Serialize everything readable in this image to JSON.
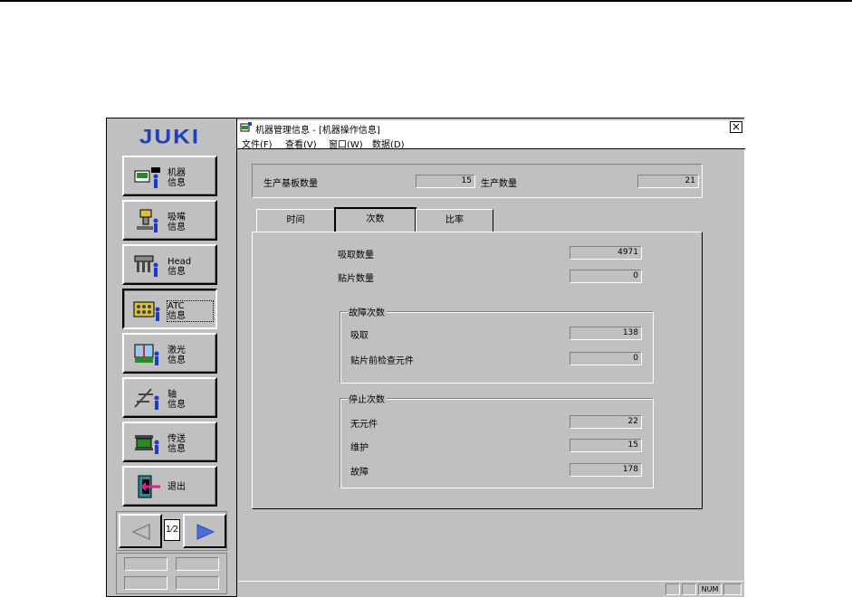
{
  "app": {
    "logo": "JUKI"
  },
  "sidebar": {
    "items": [
      {
        "label": "机器\n信息",
        "icon": "machine-info-icon"
      },
      {
        "label": "吸嘴\n信息",
        "icon": "nozzle-icon"
      },
      {
        "label": "Head\n信息",
        "icon": "head-icon"
      },
      {
        "label": "ATC\n信息",
        "icon": "atc-icon",
        "active": true
      },
      {
        "label": "激光\n信息",
        "icon": "laser-icon"
      },
      {
        "label": "轴\n信息",
        "icon": "axis-icon"
      },
      {
        "label": "传送\n信息",
        "icon": "conveyor-icon"
      },
      {
        "label": "退出",
        "icon": "exit-icon"
      }
    ],
    "pager": {
      "page": "1⁄2"
    }
  },
  "window": {
    "title": "机器管理信息 - [机器操作信息]",
    "close": "×",
    "menu": [
      "文件(F)",
      "查看(V)",
      "窗口(W)",
      "数据(D)"
    ]
  },
  "summary": {
    "board_count_label": "生产基板数量",
    "board_count": "15",
    "production_count_label": "生产数量",
    "production_count": "21"
  },
  "tabs": [
    "时间",
    "次数",
    "比率"
  ],
  "counts": {
    "pick_label": "吸取数量",
    "pick_value": "4971",
    "place_label": "贴片数量",
    "place_value": "0",
    "error_group": "故障次数",
    "error_pick_label": "吸取",
    "error_pick_value": "138",
    "error_precheck_label": "贴片前检查元件",
    "error_precheck_value": "0",
    "stop_group": "停止次数",
    "stop_noparts_label": "无元件",
    "stop_noparts_value": "22",
    "stop_maint_label": "维护",
    "stop_maint_value": "15",
    "stop_fault_label": "故障",
    "stop_fault_value": "178"
  },
  "statusbar": {
    "num": "NUM"
  },
  "colors": {
    "face": "#c0c0c0",
    "logo": "#1f3fbf",
    "arrow": "#4a6fd4"
  }
}
